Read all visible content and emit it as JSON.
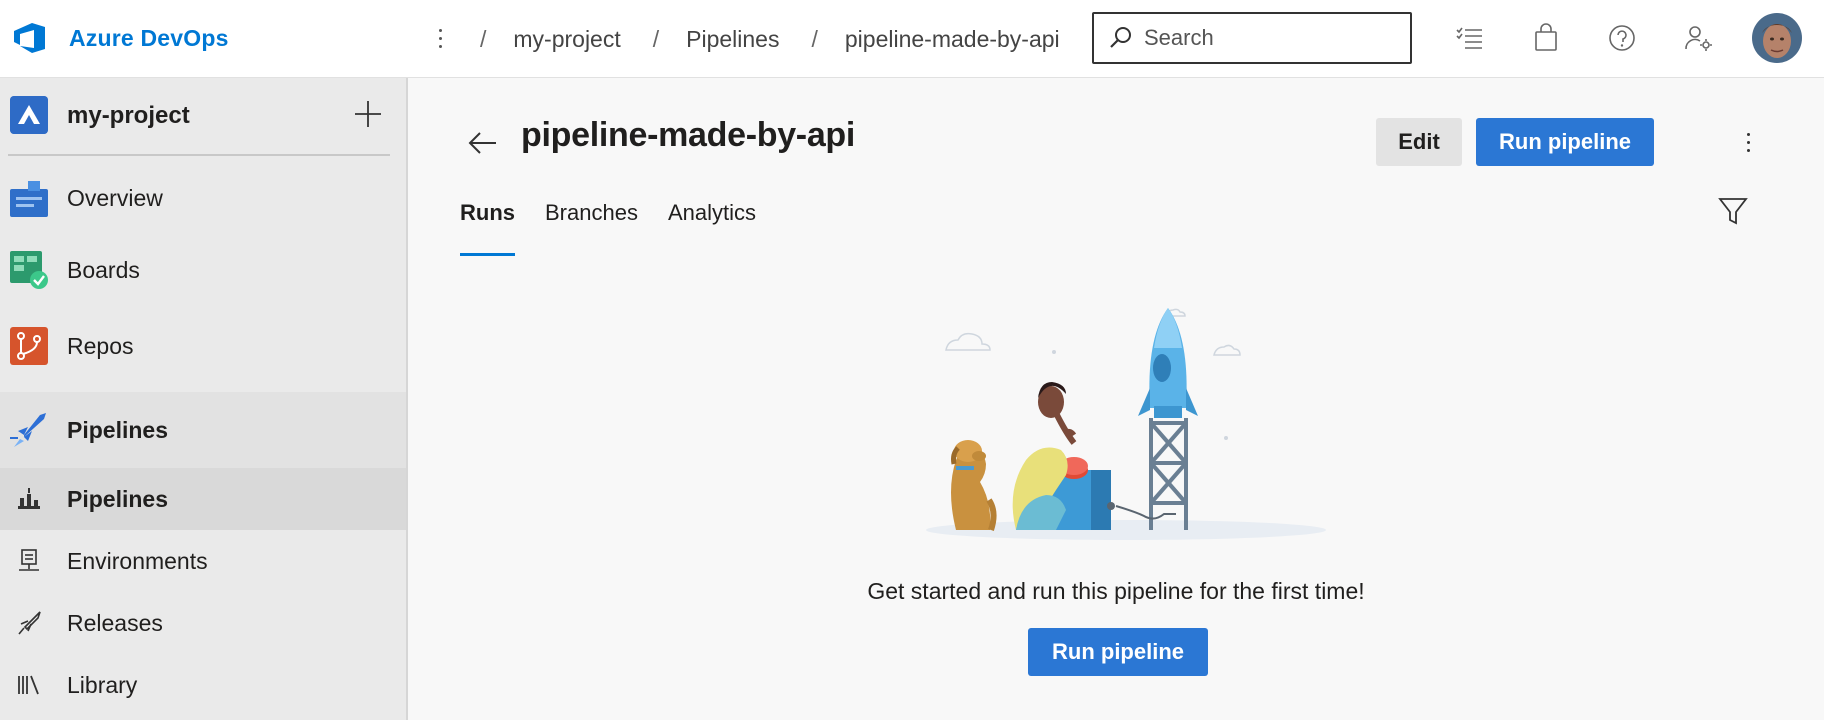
{
  "app": {
    "name": "Azure DevOps"
  },
  "breadcrumb": [
    "my-project",
    "Pipelines",
    "pipeline-made-by-api"
  ],
  "search": {
    "placeholder": "Search"
  },
  "topbar_icons": [
    "task-list-icon",
    "shopping-bag-icon",
    "help-icon",
    "user-settings-icon"
  ],
  "sidebar": {
    "project": "my-project",
    "items": [
      {
        "label": "Overview",
        "icon": "overview-icon"
      },
      {
        "label": "Boards",
        "icon": "boards-icon"
      },
      {
        "label": "Repos",
        "icon": "repos-icon"
      },
      {
        "label": "Pipelines",
        "icon": "pipelines-icon"
      },
      {
        "label": "Pipelines",
        "icon": "pipelines-sub-icon"
      },
      {
        "label": "Environments",
        "icon": "environments-icon"
      },
      {
        "label": "Releases",
        "icon": "releases-icon"
      },
      {
        "label": "Library",
        "icon": "library-icon"
      }
    ]
  },
  "main": {
    "title": "pipeline-made-by-api",
    "edit_label": "Edit",
    "run_label": "Run pipeline",
    "tabs": [
      {
        "label": "Runs",
        "active": true
      },
      {
        "label": "Branches",
        "active": false
      },
      {
        "label": "Analytics",
        "active": false
      }
    ],
    "empty_message": "Get started and run this pipeline for the first time!",
    "empty_button": "Run pipeline"
  },
  "colors": {
    "accent": "#0078d4",
    "button_primary": "#2b77d4",
    "sidebar_bg": "#eaeaea",
    "sidebar_selected": "#d9d9d9"
  }
}
